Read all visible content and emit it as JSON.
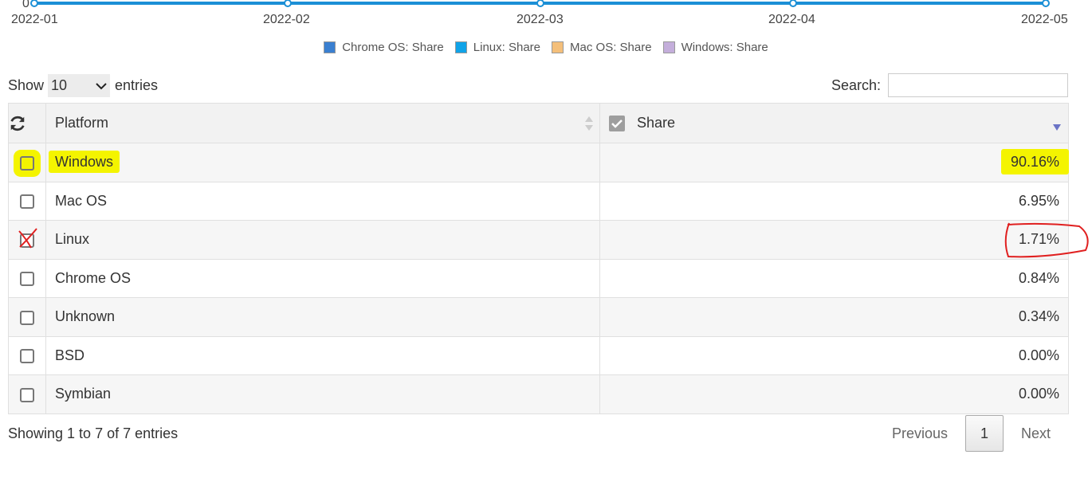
{
  "chart": {
    "y_zero_label": "0",
    "x_labels": [
      "2022-01",
      "2022-02",
      "2022-03",
      "2022-04",
      "2022-05"
    ],
    "legend": [
      {
        "label": "Chrome OS: Share",
        "color": "#3a7fd0"
      },
      {
        "label": "Linux: Share",
        "color": "#10a3e8"
      },
      {
        "label": "Mac OS: Share",
        "color": "#f4bf7a"
      },
      {
        "label": "Windows: Share",
        "color": "#c4aedb"
      }
    ],
    "line_color": "#1b8fd6"
  },
  "controls": {
    "show_label": "Show",
    "length_value": "10",
    "entries_label": "entries",
    "search_label": "Search:",
    "search_value": ""
  },
  "table": {
    "headers": {
      "platform": "Platform",
      "share": "Share"
    },
    "rows": [
      {
        "platform": "Windows",
        "share": "90.16%",
        "checked": false
      },
      {
        "platform": "Mac OS",
        "share": "6.95%",
        "checked": false
      },
      {
        "platform": "Linux",
        "share": "1.71%",
        "checked": false
      },
      {
        "platform": "Chrome OS",
        "share": "0.84%",
        "checked": false
      },
      {
        "platform": "Unknown",
        "share": "0.34%",
        "checked": false
      },
      {
        "platform": "BSD",
        "share": "0.00%",
        "checked": false
      },
      {
        "platform": "Symbian",
        "share": "0.00%",
        "checked": false
      }
    ]
  },
  "footer": {
    "info": "Showing 1 to 7 of 7 entries",
    "previous": "Previous",
    "current_page": "1",
    "next": "Next"
  },
  "annotations": {
    "highlight_color": "#f4f400",
    "pen_color": "#e02020"
  }
}
